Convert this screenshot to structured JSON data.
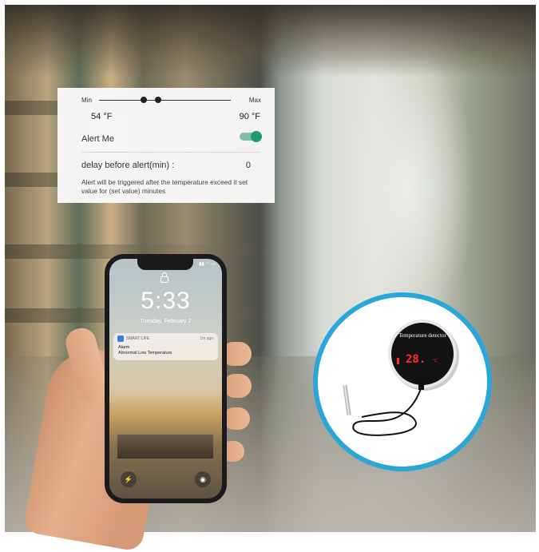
{
  "settings_card": {
    "min_label": "Min",
    "max_label": "Max",
    "min_value": "54 °F",
    "max_value": "90 °F",
    "alert_label": "Alert Me",
    "alert_enabled": true,
    "delay_label": "delay before alert(min) :",
    "delay_value": "0",
    "note": "Alert will be triggered after the temperature exceed it set value for (set value) minutes"
  },
  "phone": {
    "status": "▮▮ ◠ ▭",
    "time": "5:33",
    "date": "Tuesday, February 2",
    "notification": {
      "app": "SMART LIFE",
      "ago": "1m ago",
      "title": "Alarm",
      "body": "Abnormal Low Temperature"
    },
    "flash_icon": "flashlight-icon",
    "camera_icon": "camera-icon"
  },
  "device": {
    "label": "Temperature detector",
    "reading": "28.",
    "unit": "°C"
  },
  "colors": {
    "accent_ring": "#2aa7d9",
    "toggle_on": "#1f9a6c",
    "display_red": "#ff2a2a"
  }
}
